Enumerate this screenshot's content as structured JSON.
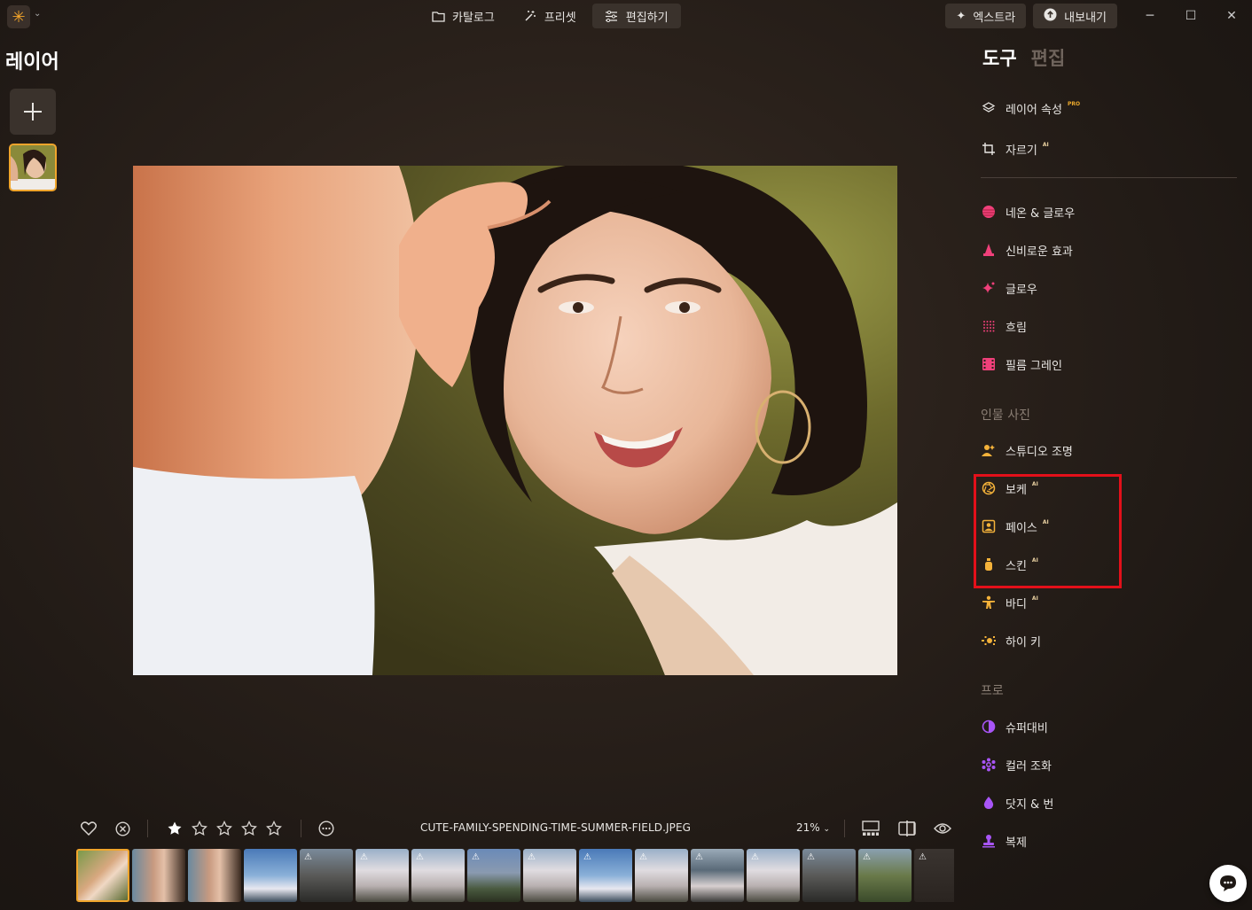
{
  "topbar": {
    "tabs": [
      {
        "label": "카탈로그",
        "icon": "folder-icon"
      },
      {
        "label": "프리셋",
        "icon": "magic-wand-icon"
      },
      {
        "label": "편집하기",
        "icon": "sliders-icon",
        "active": true
      }
    ],
    "extras_label": "엑스트라",
    "export_label": "내보내기",
    "window": {
      "minimize": "─",
      "maximize": "☐",
      "close": "✕"
    }
  },
  "layers": {
    "title": "레이어",
    "add_label": "+"
  },
  "right_panel": {
    "tabs": [
      {
        "label": "도구",
        "active": true
      },
      {
        "label": "편집",
        "active": false
      }
    ],
    "tools_top": [
      {
        "label": "레이어 속성",
        "badge": "PRO",
        "icon": "layers-icon"
      },
      {
        "label": "자르기",
        "badge": "AI",
        "icon": "crop-icon"
      }
    ],
    "tools_creative": [
      {
        "label": "네온 & 글로우",
        "icon": "neon-icon"
      },
      {
        "label": "신비로운 효과",
        "icon": "mystic-icon"
      },
      {
        "label": "글로우",
        "icon": "sparkle-icon"
      },
      {
        "label": "흐림",
        "icon": "blur-dots-icon"
      },
      {
        "label": "필름 그레인",
        "icon": "film-icon"
      }
    ],
    "portrait_title": "인물 사진",
    "tools_portrait": [
      {
        "label": "스튜디오 조명",
        "badge": "",
        "icon": "studio-light-icon"
      },
      {
        "label": "보케",
        "badge": "AI",
        "icon": "aperture-icon"
      },
      {
        "label": "페이스",
        "badge": "AI",
        "icon": "face-icon"
      },
      {
        "label": "스킨",
        "badge": "AI",
        "icon": "skin-bottle-icon"
      },
      {
        "label": "바디",
        "badge": "AI",
        "icon": "body-icon"
      },
      {
        "label": "하이 키",
        "badge": "",
        "icon": "high-key-icon"
      }
    ],
    "pro_title": "프로",
    "tools_pro": [
      {
        "label": "슈퍼대비",
        "icon": "contrast-icon"
      },
      {
        "label": "컬러 조화",
        "icon": "color-harmony-icon"
      },
      {
        "label": "닷지 & 번",
        "icon": "drop-icon"
      },
      {
        "label": "복제",
        "icon": "stamp-icon"
      }
    ]
  },
  "bottom": {
    "filename": "CUTE-FAMILY-SPENDING-TIME-SUMMER-FIELD.JPEG",
    "zoom": "21%",
    "rating": 1,
    "rating_max": 5
  },
  "filmstrip": {
    "thumbs": [
      {
        "kind": "portrait",
        "warn": false
      },
      {
        "kind": "face",
        "warn": false
      },
      {
        "kind": "face",
        "warn": false
      },
      {
        "kind": "sky",
        "warn": false
      },
      {
        "kind": "street",
        "warn": true
      },
      {
        "kind": "blossom",
        "warn": true
      },
      {
        "kind": "blossom",
        "warn": true
      },
      {
        "kind": "mountain",
        "warn": true
      },
      {
        "kind": "blossom",
        "warn": true
      },
      {
        "kind": "sky",
        "warn": true
      },
      {
        "kind": "blossom",
        "warn": true
      },
      {
        "kind": "city",
        "warn": true
      },
      {
        "kind": "blossom",
        "warn": true
      },
      {
        "kind": "street",
        "warn": true
      },
      {
        "kind": "green",
        "warn": true
      },
      {
        "kind": "dark",
        "warn": true
      }
    ],
    "warn_symbol": "⚠"
  },
  "colors": {
    "accent": "#f0a52c",
    "highlight": "#e3101a",
    "neon": "#f0407a",
    "portrait": "#f4b23a",
    "pro": "#a855f7"
  }
}
